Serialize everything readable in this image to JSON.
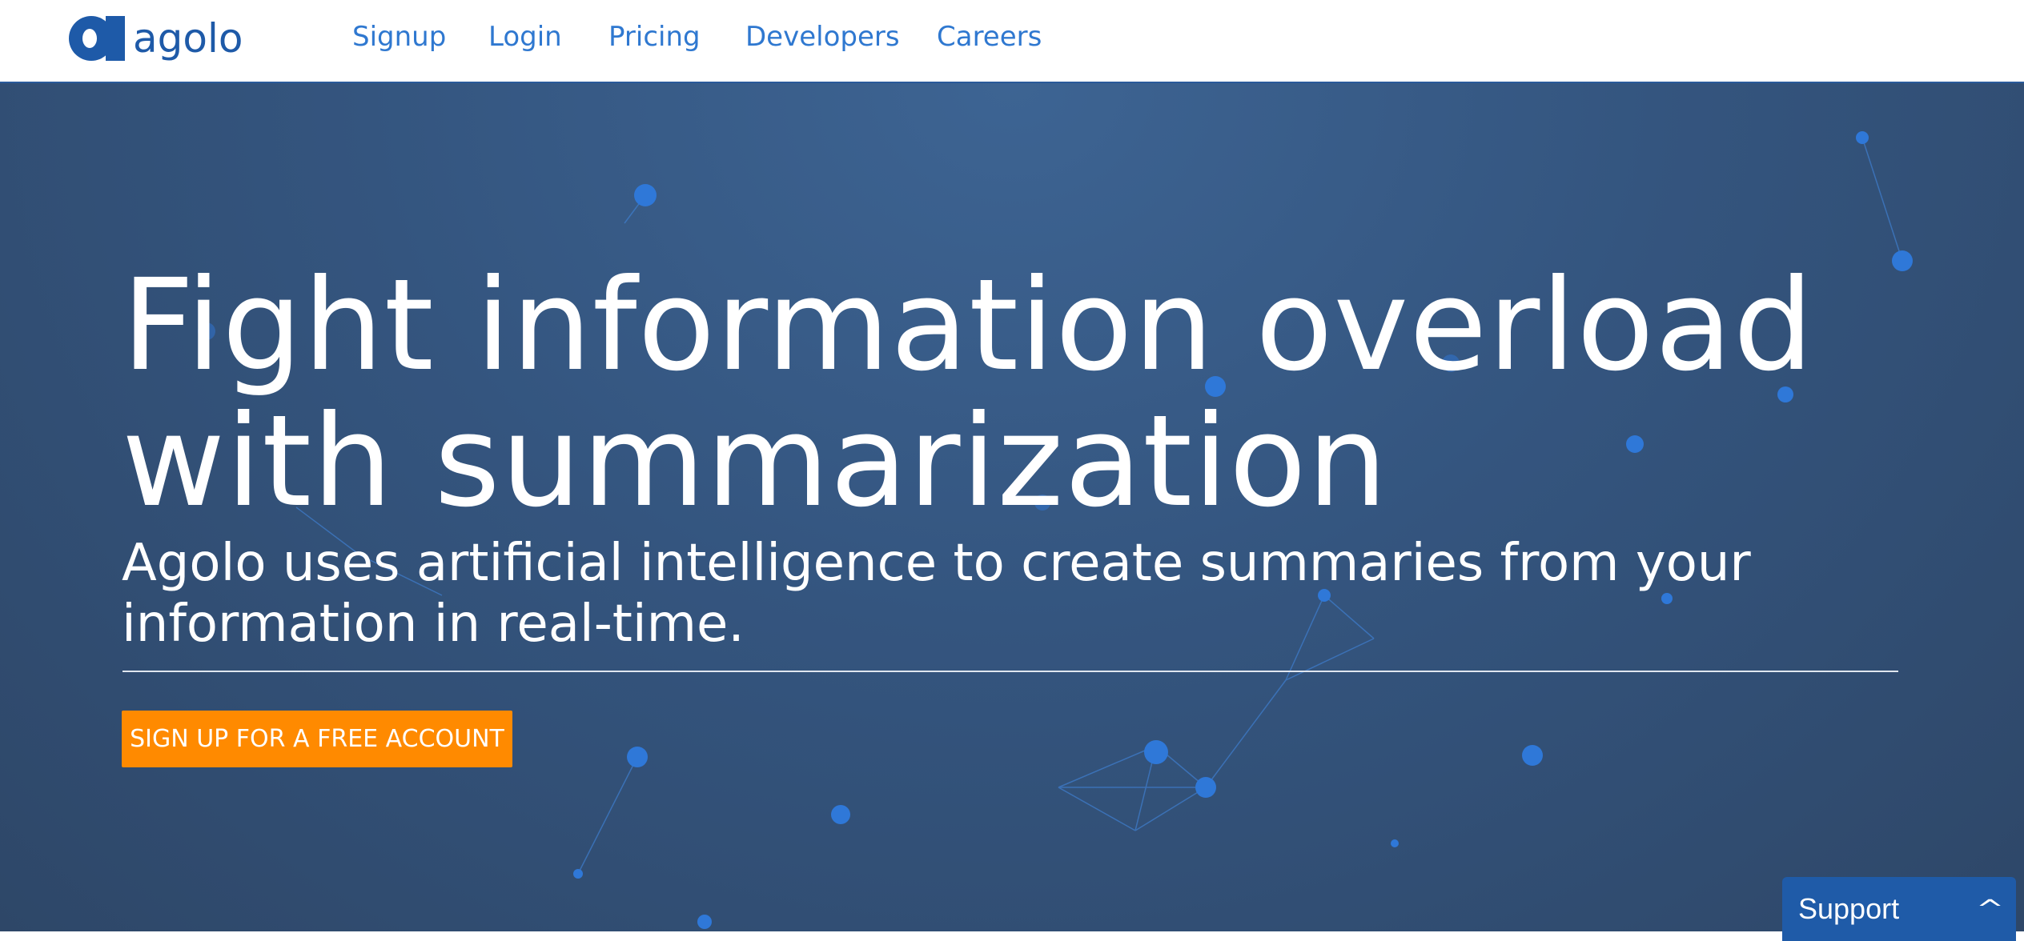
{
  "header": {
    "logo_text": "agolo",
    "nav": [
      "Signup",
      "Login",
      "Pricing",
      "Developers",
      "Careers"
    ]
  },
  "hero": {
    "headline_line1": "Fight information overload",
    "headline_line2": "with summarization",
    "subtitle": "Agolo uses artificial intelligence to create summaries from your information in real-time.",
    "cta_label": "SIGN UP FOR A FREE ACCOUNT"
  },
  "support": {
    "label": "Support",
    "icon": "chevron-up-icon"
  },
  "colors": {
    "brand": "#1e5aa8",
    "nav_link": "#2f78d0",
    "cta": "#ff8a00",
    "hero_bg": "#34557f"
  }
}
